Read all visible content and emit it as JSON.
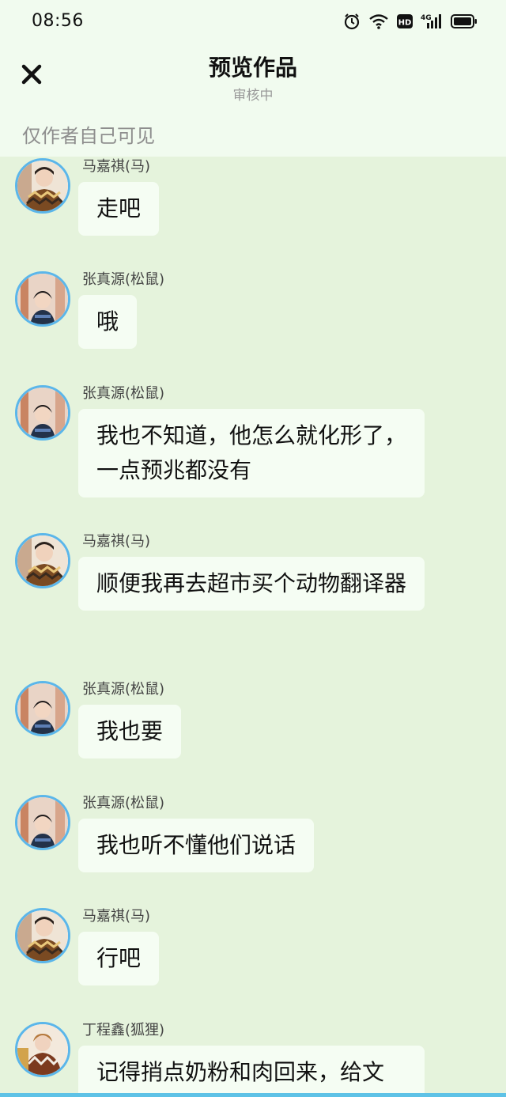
{
  "status_bar": {
    "time": "08:56",
    "icons": [
      "alarm-icon",
      "wifi-icon",
      "hd-icon",
      "signal-4g-icon",
      "battery-icon"
    ],
    "network_label": "4G",
    "hd_label": "HD"
  },
  "header": {
    "title": "预览作品",
    "subtitle": "审核中",
    "close_icon": "close-icon",
    "visibility_note": "仅作者自己可见"
  },
  "colors": {
    "chat_background": "#e5f3dc",
    "bubble": "#f5fdf3",
    "avatar_ring": "#5bb6ea"
  },
  "messages": [
    {
      "sender": "马嘉祺(马)",
      "text": "走吧",
      "avatar": "ma-avatar"
    },
    {
      "sender": "张真源(松鼠)",
      "text": "哦",
      "avatar": "zhang-avatar"
    },
    {
      "sender": "张真源(松鼠)",
      "text": "我也不知道，他怎么就化形了，一点预兆都没有",
      "avatar": "zhang-avatar"
    },
    {
      "sender": "马嘉祺(马)",
      "text": "顺便我再去超市买个动物翻译器",
      "avatar": "ma-avatar"
    },
    {
      "sender": "张真源(松鼠)",
      "text": "我也要",
      "avatar": "zhang-avatar"
    },
    {
      "sender": "张真源(松鼠)",
      "text": "我也听不懂他们说话",
      "avatar": "zhang-avatar"
    },
    {
      "sender": "马嘉祺(马)",
      "text": "行吧",
      "avatar": "ma-avatar"
    },
    {
      "sender": "丁程鑫(狐狸)",
      "text": "记得捎点奶粉和肉回来，给文",
      "avatar": "ding-avatar"
    }
  ]
}
